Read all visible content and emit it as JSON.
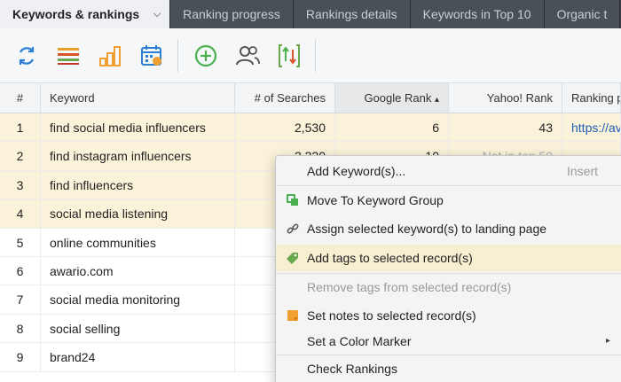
{
  "tabs": [
    {
      "label": "Keywords & rankings",
      "active": true
    },
    {
      "label": "Ranking progress"
    },
    {
      "label": "Rankings details"
    },
    {
      "label": "Keywords in Top 10"
    },
    {
      "label": "Organic t"
    }
  ],
  "table": {
    "headers": {
      "num": "#",
      "keyword": "Keyword",
      "searches": "# of Searches",
      "google": "Google Rank",
      "google_sort": "▴",
      "yahoo": "Yahoo! Rank",
      "url": "Ranking p"
    },
    "rows": [
      {
        "num": "1",
        "keyword": "find social media influencers",
        "searches": "2,530",
        "google": "6",
        "yahoo": "43",
        "url": "https://av"
      },
      {
        "num": "2",
        "keyword": "find instagram influencers",
        "searches": "2,320",
        "google": "10",
        "yahoo": "Not in top 50",
        "url": ""
      },
      {
        "num": "3",
        "keyword": "find influencers",
        "searches": "",
        "google": "",
        "yahoo": "",
        "url": ""
      },
      {
        "num": "4",
        "keyword": "social media listening",
        "searches": "",
        "google": "",
        "yahoo": "",
        "url": ""
      },
      {
        "num": "5",
        "keyword": "online communities",
        "searches": "",
        "google": "",
        "yahoo": "",
        "url": ""
      },
      {
        "num": "6",
        "keyword": "awario.com",
        "searches": "",
        "google": "",
        "yahoo": "",
        "url": ""
      },
      {
        "num": "7",
        "keyword": "social media monitoring",
        "searches": "",
        "google": "",
        "yahoo": "",
        "url": ""
      },
      {
        "num": "8",
        "keyword": "social selling",
        "searches": "",
        "google": "",
        "yahoo": "",
        "url": ""
      },
      {
        "num": "9",
        "keyword": "brand24",
        "searches": "",
        "google": "",
        "yahoo": "",
        "url": ""
      }
    ]
  },
  "menu": {
    "add_keywords": "Add Keyword(s)...",
    "add_keywords_shortcut": "Insert",
    "move_group": "Move To Keyword Group",
    "assign_landing": "Assign selected keyword(s) to landing page",
    "add_tags": "Add tags to selected record(s)",
    "remove_tags": "Remove tags from selected record(s)",
    "set_notes": "Set notes to selected record(s)",
    "color_marker": "Set a Color Marker",
    "check_rankings": "Check Rankings",
    "submenu_arrow": "▸"
  },
  "colors": {
    "accent_blue": "#2a7fd4",
    "tag_green": "#6aa84f",
    "notes_orange": "#f0a030",
    "row_highlight": "#fbf3d9"
  }
}
